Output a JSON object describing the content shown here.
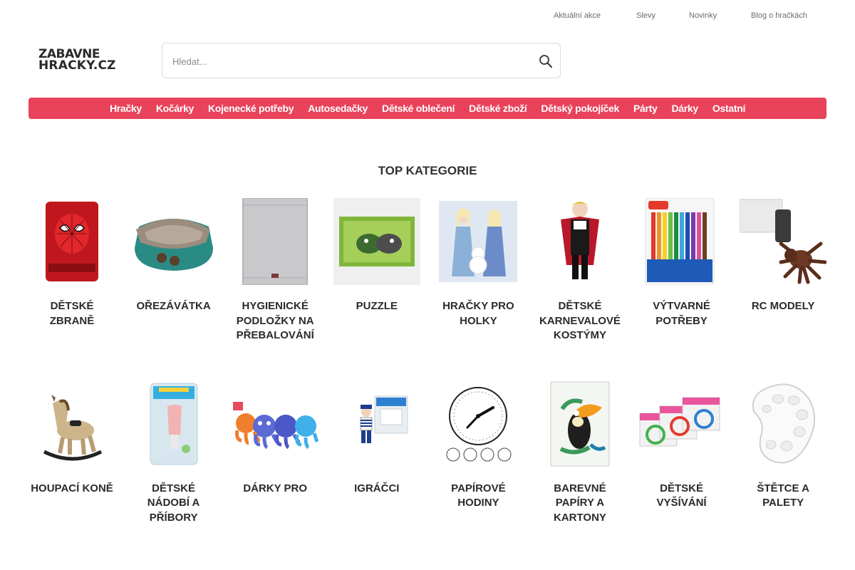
{
  "top_links": [
    {
      "label": "Aktuální akce"
    },
    {
      "label": "Slevy"
    },
    {
      "label": "Novinky"
    },
    {
      "label": "Blog o hračkách"
    }
  ],
  "logo": {
    "line1": "ZABAVNE",
    "line2": "HRACKY.CZ"
  },
  "search": {
    "placeholder": "Hledat...",
    "value": ""
  },
  "menu": [
    {
      "label": "Hračky"
    },
    {
      "label": "Kočárky"
    },
    {
      "label": "Kojenecké potřeby"
    },
    {
      "label": "Autosedačky"
    },
    {
      "label": "Dětské oblečení"
    },
    {
      "label": "Dětské zboží"
    },
    {
      "label": "Dětský pokojíček"
    },
    {
      "label": "Párty"
    },
    {
      "label": "Dárky"
    },
    {
      "label": "Ostatní"
    }
  ],
  "section_title": "TOP KATEGORIE",
  "categories": [
    {
      "label": "Dětské zbraně",
      "icon": "spiderman-blanket"
    },
    {
      "label": "Ořezávátka",
      "icon": "sharpener"
    },
    {
      "label": "Hygienické podložky na přebalování",
      "icon": "changing-mat"
    },
    {
      "label": "Puzzle",
      "icon": "puzzle"
    },
    {
      "label": "Hračky pro holky",
      "icon": "frozen-dolls"
    },
    {
      "label": "Dětské karnevalové kostýmy",
      "icon": "costume"
    },
    {
      "label": "Výtvarné potřeby",
      "icon": "markers"
    },
    {
      "label": "RC modely",
      "icon": "rc-spider"
    },
    {
      "label": "Houpací koně",
      "icon": "rocking-horse"
    },
    {
      "label": "Dětské nádobí a příbory",
      "icon": "baby-feeder"
    },
    {
      "label": "Dárky pro",
      "icon": "octopus-toys"
    },
    {
      "label": "Igráčci",
      "icon": "igracek"
    },
    {
      "label": "Papírové hodiny",
      "icon": "paper-clock"
    },
    {
      "label": "Barevné papíry a kartony",
      "icon": "toucan-paper"
    },
    {
      "label": "Dětské vyšívání",
      "icon": "embroidery-kits"
    },
    {
      "label": "Štětce a palety",
      "icon": "palette"
    }
  ],
  "colors": {
    "accent": "#e8435a",
    "text": "#2b2b2b",
    "muted": "#6b6b6b"
  }
}
